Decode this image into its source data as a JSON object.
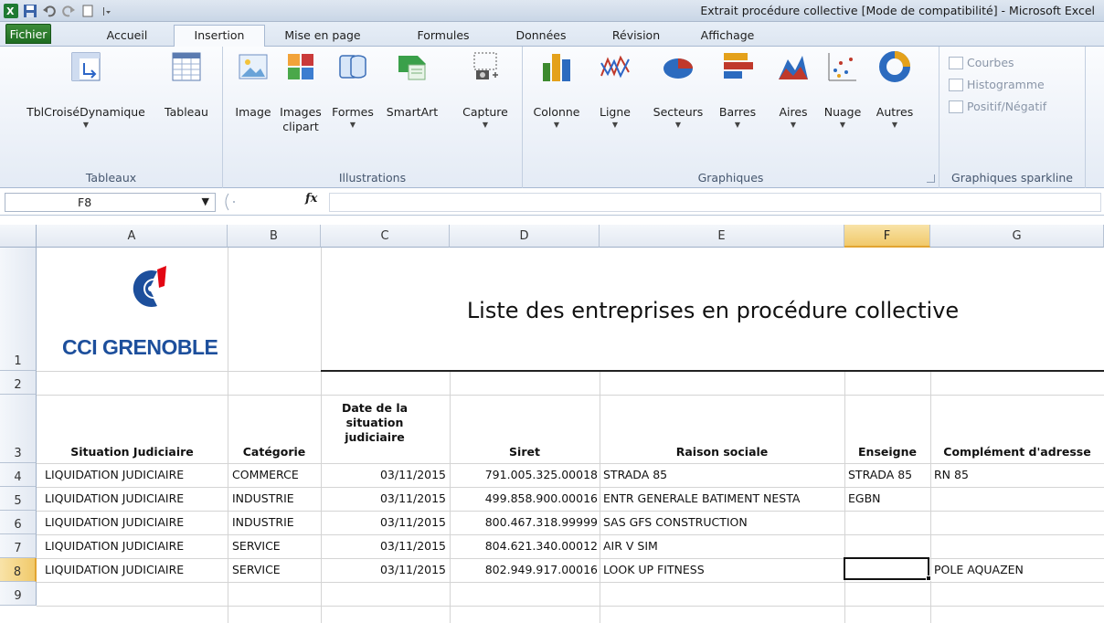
{
  "window": {
    "title": "Extrait procédure collective  [Mode de compatibilité]  -  Microsoft Excel"
  },
  "tabs": [
    "Fichier",
    "Accueil",
    "Insertion",
    "Mise en page",
    "Formules",
    "Données",
    "Révision",
    "Affichage"
  ],
  "active_tab": "Insertion",
  "ribbon": {
    "groups": {
      "tableaux": "Tableaux",
      "illustrations": "Illustrations",
      "graphiques": "Graphiques",
      "sparklines": "Graphiques sparkline"
    },
    "buttons": {
      "tbl_croise": "TblCroiséDynamique",
      "tableau": "Tableau",
      "image": "Image",
      "images_clipart_1": "Images",
      "images_clipart_2": "clipart",
      "formes": "Formes",
      "smartart": "SmartArt",
      "capture": "Capture",
      "colonne": "Colonne",
      "ligne": "Ligne",
      "secteurs": "Secteurs",
      "barres": "Barres",
      "aires": "Aires",
      "nuage": "Nuage",
      "autres": "Autres"
    },
    "sparklines": {
      "courbes": "Courbes",
      "histogramme": "Histogramme",
      "positif_negatif": "Positif/Négatif"
    }
  },
  "formula_bar": {
    "name_box": "F8",
    "fx": "fx",
    "formula": ""
  },
  "sheet": {
    "columns": [
      "A",
      "B",
      "C",
      "D",
      "E",
      "F",
      "G"
    ],
    "selected_column": "F",
    "rows": [
      "1",
      "2",
      "3",
      "4",
      "5",
      "6",
      "7",
      "8",
      "9"
    ],
    "selected_row": "8",
    "logo_text": "CCI GRENOBLE",
    "title": "Liste des entreprises en procédure collective",
    "headers": {
      "situation": "Situation Judiciaire",
      "categorie": "Catégorie",
      "date_1": "Date de la",
      "date_2": "situation",
      "date_3": "judiciaire",
      "siret": "Siret",
      "raison": "Raison sociale",
      "enseigne": "Enseigne",
      "complement": "Complément d'adresse"
    },
    "data": [
      {
        "situation": "LIQUIDATION JUDICIAIRE",
        "categorie": "COMMERCE",
        "date": "03/11/2015",
        "siret": "791.005.325.00018",
        "raison": "STRADA 85",
        "enseigne": "STRADA 85",
        "complement": "RN 85"
      },
      {
        "situation": "LIQUIDATION JUDICIAIRE",
        "categorie": "INDUSTRIE",
        "date": "03/11/2015",
        "siret": "499.858.900.00016",
        "raison": "ENTR GENERALE BATIMENT NESTA",
        "enseigne": "EGBN",
        "complement": ""
      },
      {
        "situation": "LIQUIDATION JUDICIAIRE",
        "categorie": "INDUSTRIE",
        "date": "03/11/2015",
        "siret": "800.467.318.99999",
        "raison": "SAS GFS CONSTRUCTION",
        "enseigne": "",
        "complement": ""
      },
      {
        "situation": "LIQUIDATION JUDICIAIRE",
        "categorie": "SERVICE",
        "date": "03/11/2015",
        "siret": "804.621.340.00012",
        "raison": "AIR V SIM",
        "enseigne": "",
        "complement": ""
      },
      {
        "situation": "LIQUIDATION JUDICIAIRE",
        "categorie": "SERVICE",
        "date": "03/11/2015",
        "siret": "802.949.917.00016",
        "raison": "LOOK UP FITNESS",
        "enseigne": "",
        "complement": "POLE AQUAZEN"
      }
    ]
  }
}
